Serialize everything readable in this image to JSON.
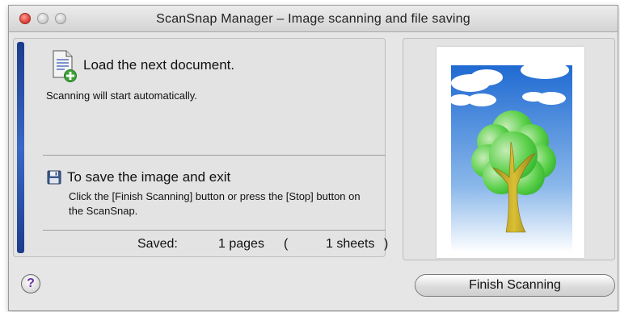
{
  "window": {
    "title": "ScanSnap Manager – Image scanning and file saving"
  },
  "prompt": {
    "title": "Load the next document.",
    "subtitle": "Scanning will start automatically."
  },
  "save": {
    "title": "To save the image and exit",
    "description": "Click the [Finish Scanning] button or press the [Stop] button on the ScanSnap."
  },
  "status": {
    "saved_label": "Saved:",
    "pages": "1 pages",
    "paren_open": "(",
    "sheets": "1 sheets",
    "paren_close": ")"
  },
  "buttons": {
    "help": "?",
    "finish": "Finish Scanning"
  },
  "icons": {
    "next_document": "document-add-icon",
    "save": "floppy-disk-icon",
    "help": "help-icon"
  },
  "colors": {
    "progress": "#2a51ae",
    "help_accent": "#6a2fa3"
  }
}
